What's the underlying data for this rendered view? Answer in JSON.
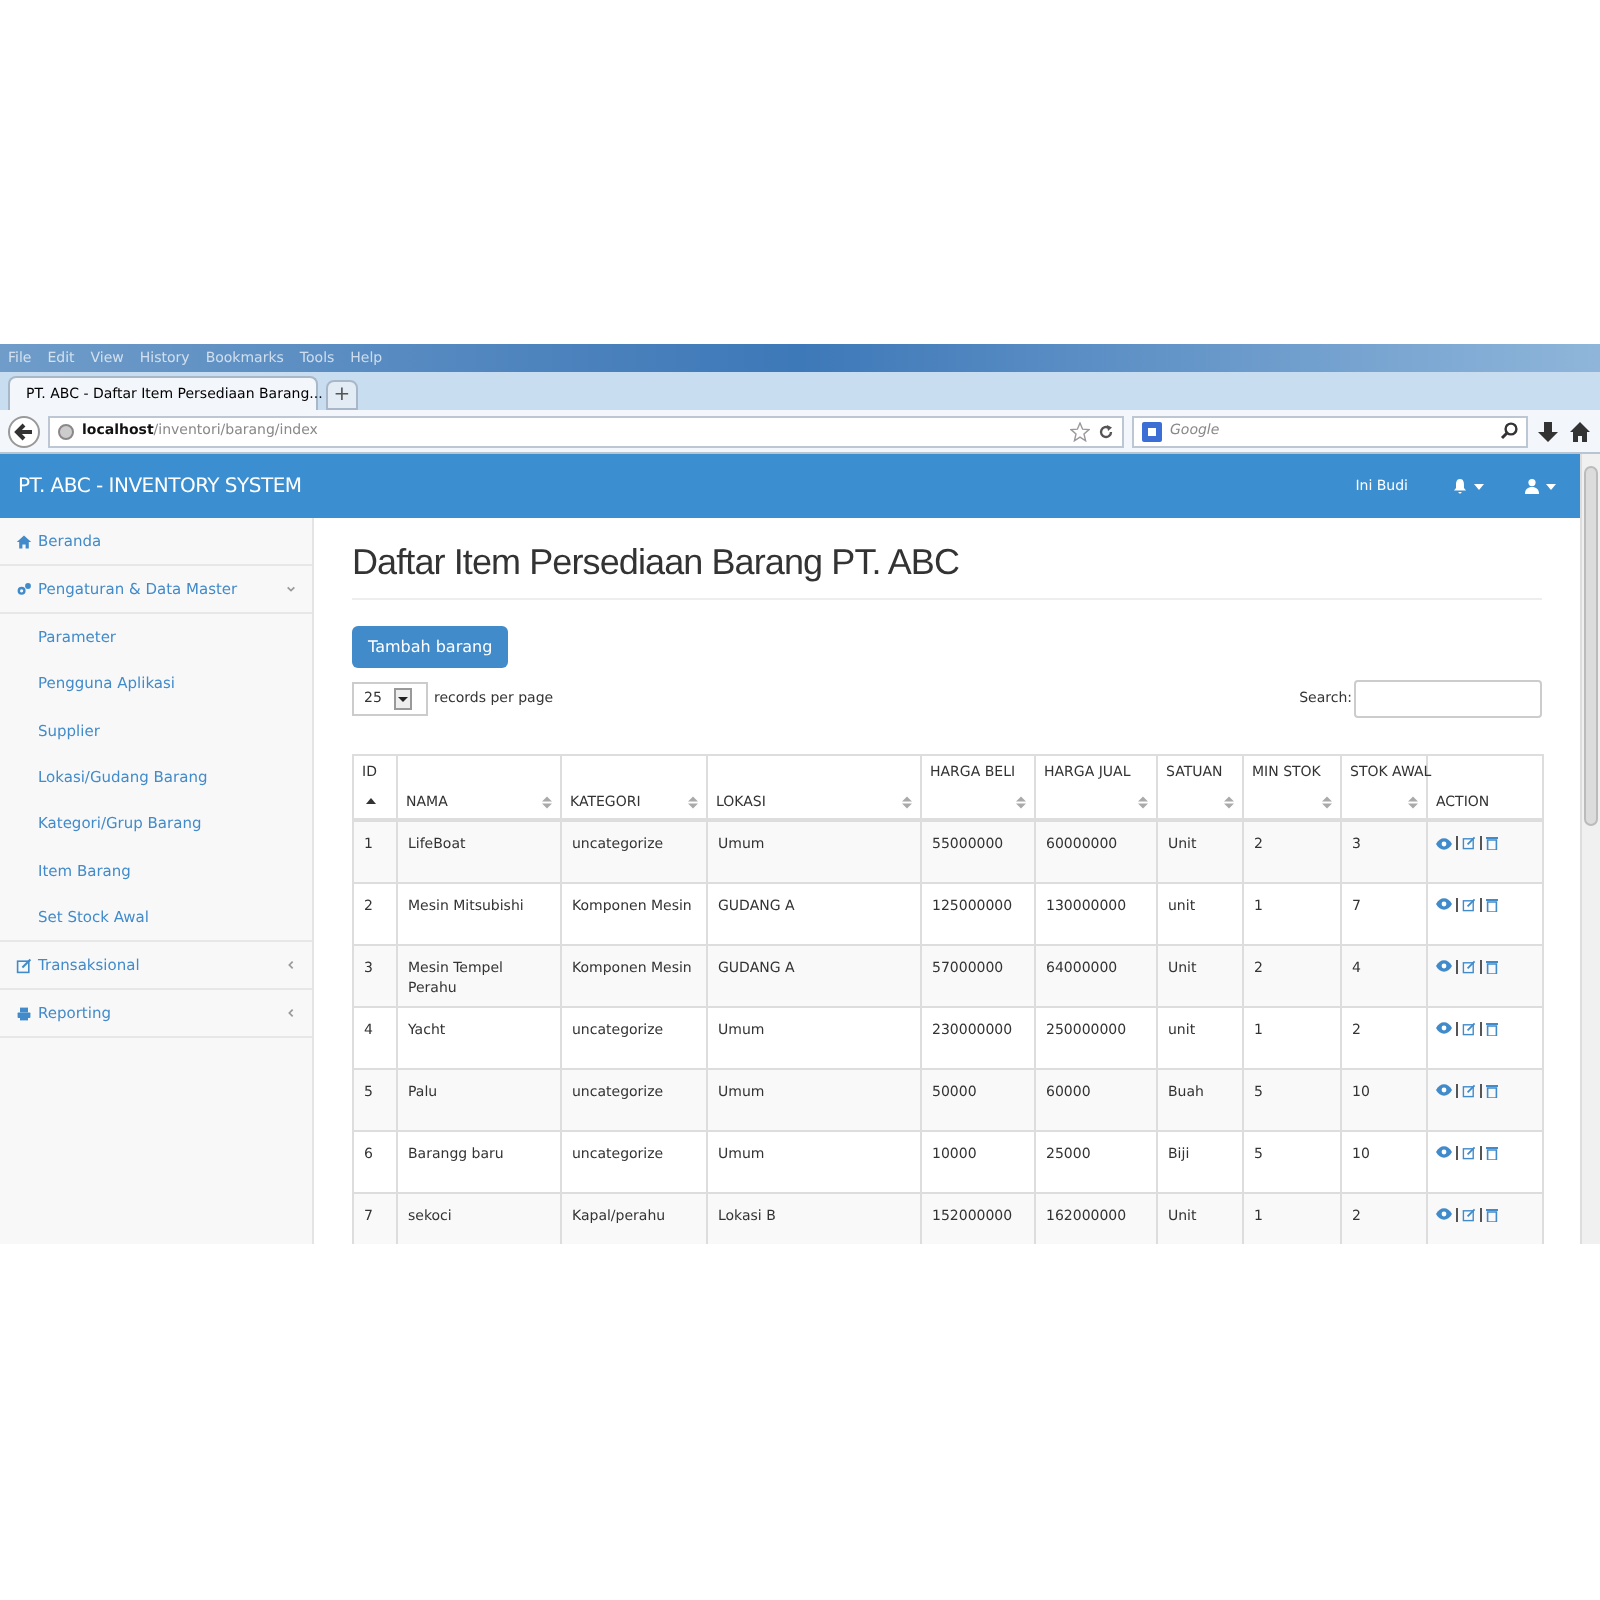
{
  "browser": {
    "menu": [
      "File",
      "Edit",
      "View",
      "History",
      "Bookmarks",
      "Tools",
      "Help"
    ],
    "tab": {
      "title": "PT. ABC - Daftar Item Persediaan Barang...",
      "selected": true
    },
    "tab_add": "+",
    "address": {
      "host": "localhost",
      "path": "/inventori/barang/index"
    },
    "search": {
      "placeholder": "Google"
    }
  },
  "header": {
    "brand": "PT. ABC - INVENTORY SYSTEM",
    "user": "Ini Budi"
  },
  "sidebar": {
    "items": [
      {
        "label": "Beranda"
      },
      {
        "label": "Pengaturan & Data Master",
        "expanded": true,
        "children": [
          {
            "label": "Parameter"
          },
          {
            "label": "Pengguna Aplikasi"
          },
          {
            "label": "Supplier"
          },
          {
            "label": "Lokasi/Gudang Barang"
          },
          {
            "label": "Kategori/Grup Barang"
          },
          {
            "label": "Item Barang"
          },
          {
            "label": "Set Stock Awal"
          }
        ]
      },
      {
        "label": "Transaksional",
        "expanded": false
      },
      {
        "label": "Reporting",
        "expanded": false
      }
    ]
  },
  "page": {
    "title": "Daftar Item Persediaan Barang PT. ABC",
    "add_button": "Tambah barang",
    "page_size": {
      "value": "25",
      "label": "records per page"
    },
    "search_label": "Search:"
  },
  "table": {
    "columns": [
      {
        "label": "ID",
        "kind": "sorted"
      },
      {
        "label": "NAMA",
        "kind": "sortable"
      },
      {
        "label": "KATEGORI",
        "kind": "sortable"
      },
      {
        "label": "LOKASI",
        "kind": "sortable"
      },
      {
        "label": "HARGA BELI",
        "kind": "sortable"
      },
      {
        "label": "HARGA JUAL",
        "kind": "sortable"
      },
      {
        "label": "SATUAN",
        "kind": "sortable"
      },
      {
        "label": "MIN STOK",
        "kind": "sortable"
      },
      {
        "label": "STOK AWAL",
        "kind": "sortable"
      },
      {
        "label": "ACTION",
        "kind": "plain"
      }
    ],
    "rows": [
      [
        "1",
        "LifeBoat",
        "uncategorize",
        "Umum",
        "55000000",
        "60000000",
        "Unit",
        "2",
        "3"
      ],
      [
        "2",
        "Mesin Mitsubishi",
        "Komponen Mesin",
        "GUDANG A",
        "125000000",
        "130000000",
        "unit",
        "1",
        "7"
      ],
      [
        "3",
        "Mesin Tempel Perahu",
        "Komponen Mesin",
        "GUDANG A",
        "57000000",
        "64000000",
        "Unit",
        "2",
        "4"
      ],
      [
        "4",
        "Yacht",
        "uncategorize",
        "Umum",
        "230000000",
        "250000000",
        "unit",
        "1",
        "2"
      ],
      [
        "5",
        "Palu",
        "uncategorize",
        "Umum",
        "50000",
        "60000",
        "Buah",
        "5",
        "10"
      ],
      [
        "6",
        "Barangg baru",
        "uncategorize",
        "Umum",
        "10000",
        "25000",
        "Biji",
        "5",
        "10"
      ],
      [
        "7",
        "sekoci",
        "Kapal/perahu",
        "Lokasi B",
        "152000000",
        "162000000",
        "Unit",
        "1",
        "2"
      ]
    ]
  }
}
